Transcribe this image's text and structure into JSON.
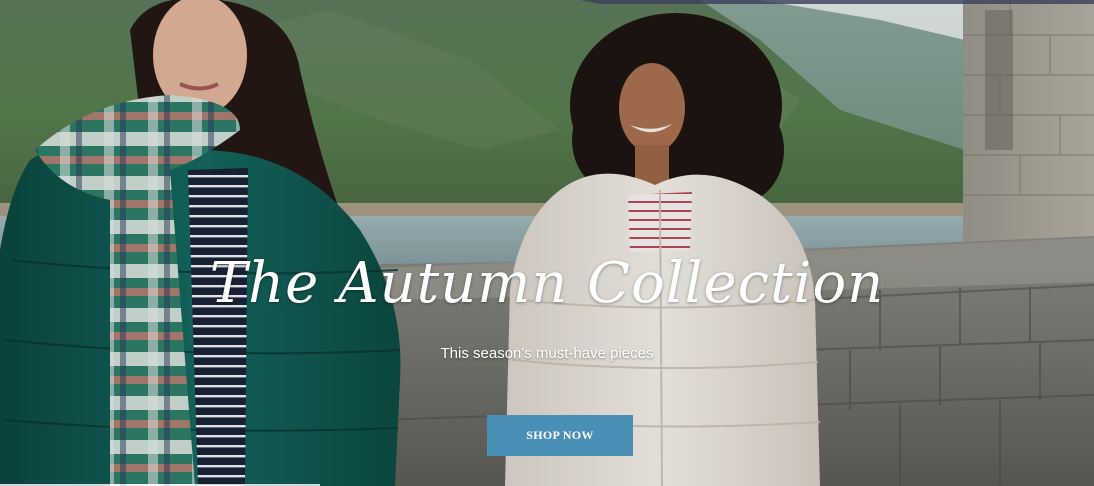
{
  "hero": {
    "title": "The Autumn Collection",
    "subtitle": "This season's must-have pieces",
    "cta_label": "SHOP NOW"
  },
  "colors": {
    "cta_background": "#4a8fb5",
    "text": "#ffffff"
  }
}
